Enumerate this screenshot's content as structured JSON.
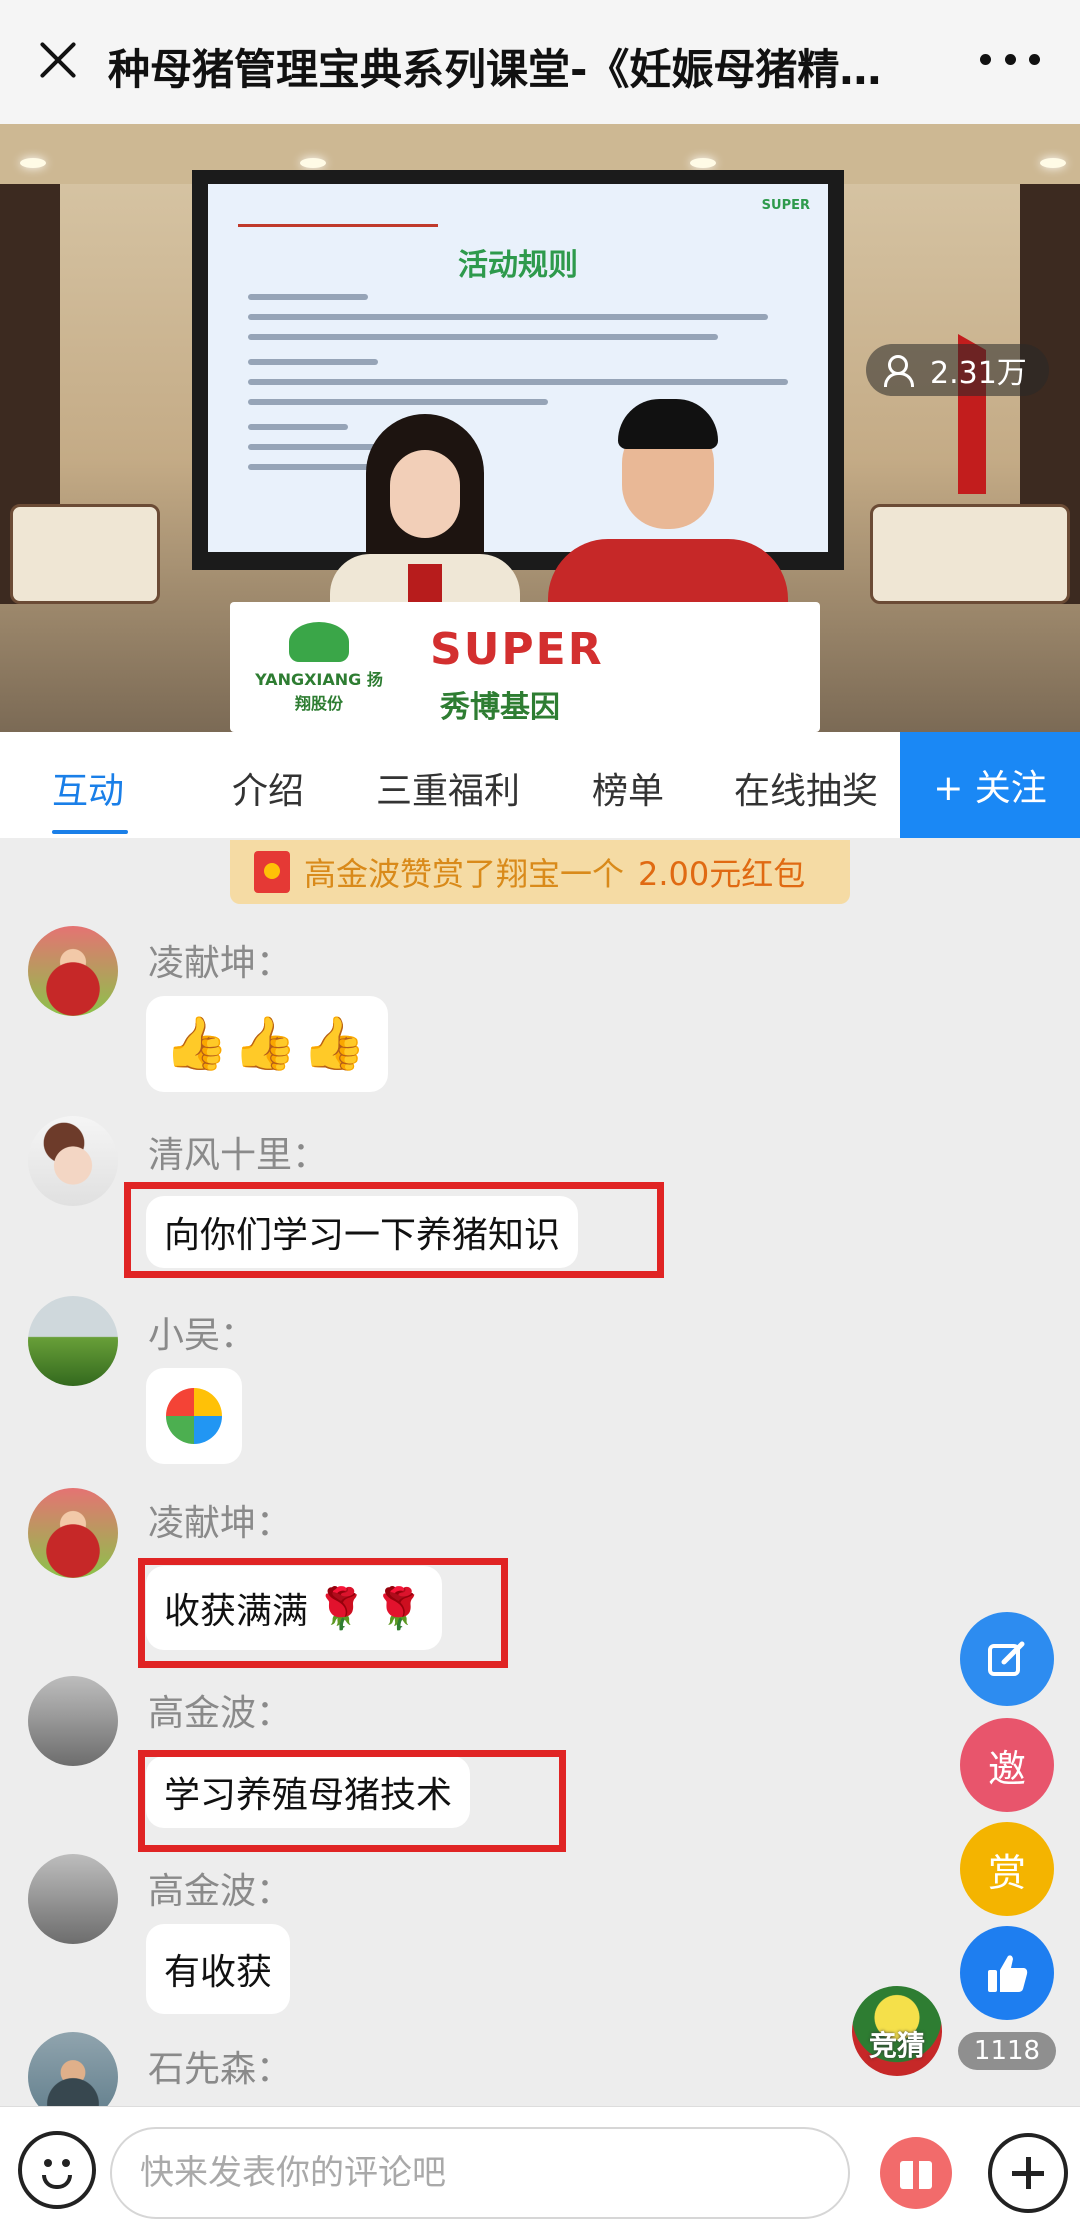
{
  "header": {
    "title": "种母猪管理宝典系列课堂-《妊娠母猪精…"
  },
  "video": {
    "slide_title": "活动规则",
    "slide_brand": "SUPER",
    "desk_brand_left": "YANGXIANG 扬翔股份",
    "desk_brand_right": "SUPER",
    "desk_brand_right_sub": "秀博基因",
    "viewer_count": "2.31万"
  },
  "tabs": [
    {
      "label": "互动"
    },
    {
      "label": "介绍"
    },
    {
      "label": "三重福利"
    },
    {
      "label": "榜单"
    },
    {
      "label": "在线抽奖"
    }
  ],
  "follow_label": "+ 关注",
  "gift_notice": {
    "text": "高金波赞赏了翔宝一个",
    "amount": "2.00元红包"
  },
  "messages": [
    {
      "user": "凌献坤：",
      "content": "👍👍👍"
    },
    {
      "user": "清风十里：",
      "content": "向你们学习一下养猪知识"
    },
    {
      "user": "小吴：",
      "content": ""
    },
    {
      "user": "凌献坤：",
      "content": "收获满满"
    },
    {
      "user": "高金波：",
      "content": "学习养殖母猪技术"
    },
    {
      "user": "高金波：",
      "content": "有收获"
    },
    {
      "user": "石先森：",
      "content": ""
    }
  ],
  "side_buttons": {
    "invite_label": "邀",
    "reward_label": "赏",
    "like_count": "1118",
    "guess_label": "竞猜"
  },
  "comment": {
    "placeholder": "快来发表你的评论吧"
  },
  "colors": {
    "accent": "#1a88f5",
    "highlight_box": "#e02424",
    "gift_banner": "#f5dba4"
  }
}
